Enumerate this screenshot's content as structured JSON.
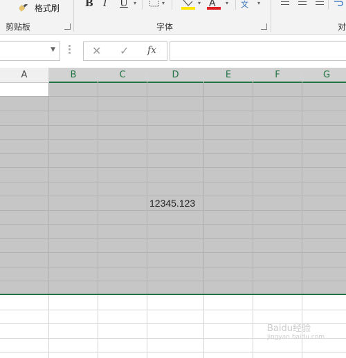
{
  "ribbon": {
    "format_painter": "格式刷",
    "clipboard_group": "剪贴板",
    "font_group": "字体",
    "alignment_group_partial": "对",
    "bold": "B",
    "italic": "I",
    "underline": "U",
    "font_color": "A",
    "phonetic": "文",
    "font_color_hex": "#e02020",
    "highlight_hex": "#ffe600"
  },
  "formula_bar": {
    "name_box_value": "",
    "cancel_symbol": "✕",
    "enter_symbol": "✓",
    "fx_label": "fx",
    "formula_value": ""
  },
  "columns": [
    "A",
    "B",
    "C",
    "D",
    "E",
    "F",
    "G"
  ],
  "cell_value": "12345.123",
  "watermark": {
    "line1": "Baidu经验",
    "line2": "jingyan.baidu.com"
  },
  "colors": {
    "selection": "#c6c6c6",
    "accent": "#217346"
  }
}
